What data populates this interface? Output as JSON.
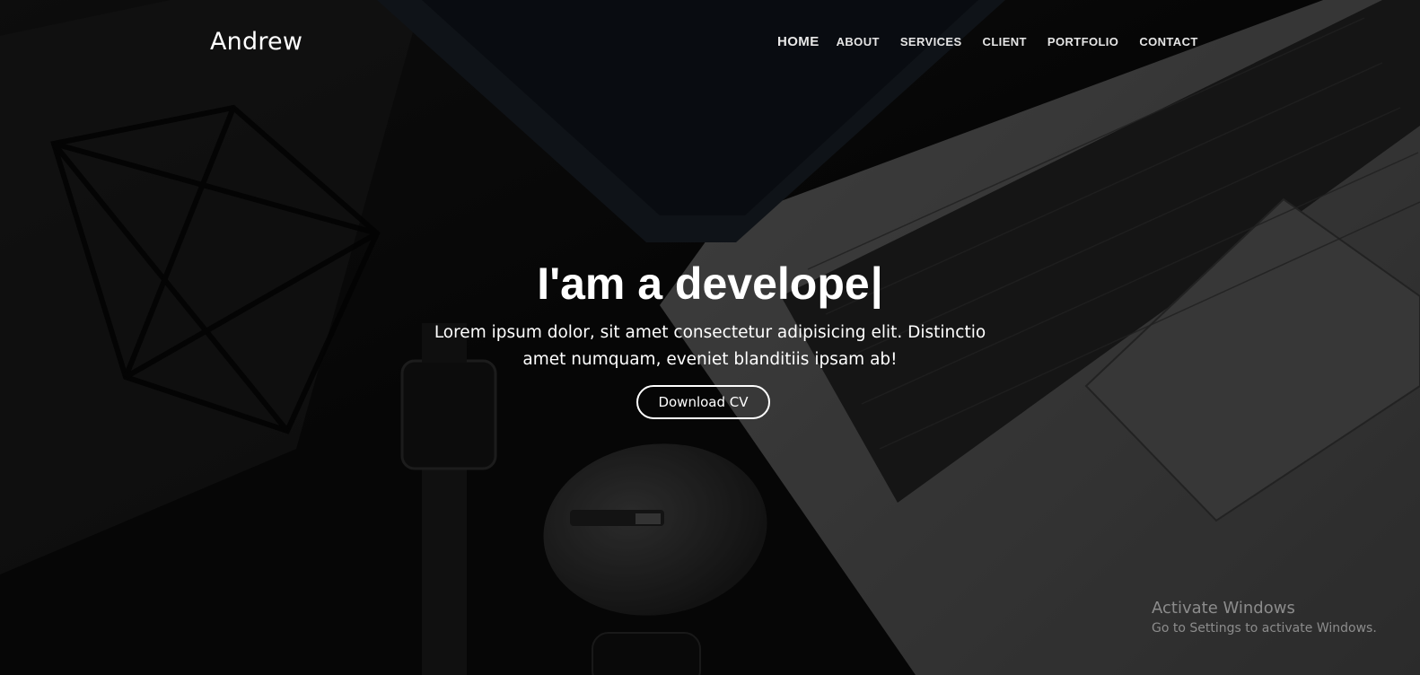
{
  "brand": {
    "name": "Andrew"
  },
  "nav": {
    "items": [
      {
        "label": "HOME"
      },
      {
        "label": "ABOUT"
      },
      {
        "label": "SERVICES"
      },
      {
        "label": "CLIENT"
      },
      {
        "label": "PORTFOLIO"
      },
      {
        "label": "CONTACT"
      }
    ],
    "active_index": 0
  },
  "hero": {
    "headline": "I'am a develope",
    "cursor": "|",
    "subtitle": "Lorem ipsum dolor, sit amet consectetur adipisicing elit. Distinctio amet numquam, eveniet blanditiis ipsam ab!",
    "cta_label": "Download CV"
  },
  "watermark": {
    "title": "Activate Windows",
    "subtitle": "Go to Settings to activate Windows."
  },
  "colors": {
    "text": "#ffffff",
    "nav_text": "#e6e6e6",
    "background": "#050505",
    "watermark": "#8c8c8c"
  },
  "background_image": {
    "icon_names": [
      "laptop-icon",
      "smartwatch-icon",
      "mouse-icon",
      "wire-sculpture-icon"
    ]
  }
}
